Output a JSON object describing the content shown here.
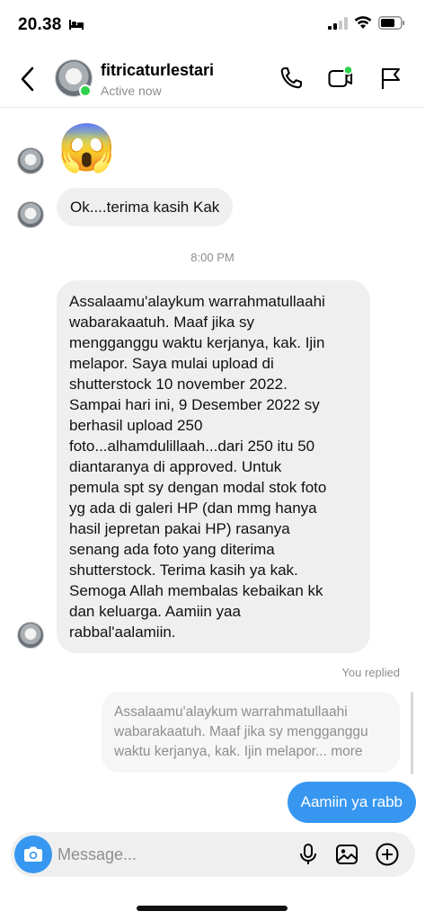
{
  "status_bar": {
    "time": "20.38",
    "icons": [
      "bed-icon",
      "signal-icon",
      "wifi-icon",
      "battery-icon"
    ]
  },
  "header": {
    "back_icon": "chevron-left-icon",
    "name": "fitricaturlestari",
    "status": "Active now",
    "actions": [
      "phone-icon",
      "video-icon",
      "flag-icon"
    ]
  },
  "chat": {
    "emoji_message": "😱",
    "message_1": "Ok....terima kasih Kak",
    "timestamp": "8:00 PM",
    "message_2": "Assalaamu'alaykum warrahmatullaahi\nwabarakaatuh. Maaf jika sy\nmengganggu waktu kerjanya, kak. Ijin\nmelapor. Saya mulai upload di\nshutterstock 10 november 2022.\nSampai hari ini, 9 Desember 2022 sy\nberhasil upload 250\nfoto...alhamdulillaah...dari 250 itu 50\ndiantaranya di approved. Untuk\npemula spt sy dengan modal stok foto\nyg ada di galeri HP (dan mmg hanya\nhasil jepretan pakai HP) rasanya\nsenang ada foto yang diterima\nshutterstock. Terima kasih ya kak.\nSemoga Allah membalas kebaikan kk\ndan keluarga. Aamiin yaa\nrabbal'aalamiin.",
    "you_replied": "You replied",
    "reply_quote": "Assalaamu'alaykum warrahmatullaahi\nwabarakaatuh. Maaf jika sy mengganggu\nwaktu kerjanya, kak. Ijin melapor... more",
    "sent_message": "Aamiin ya rabb"
  },
  "composer": {
    "placeholder": "Message...",
    "icons": [
      "camera-icon",
      "microphone-icon",
      "gallery-icon",
      "add-circle-icon"
    ]
  },
  "colors": {
    "accent": "#3797f0",
    "online": "#2bd24a",
    "incoming_bubble": "#efefef",
    "muted_text": "#8e8e8e"
  }
}
